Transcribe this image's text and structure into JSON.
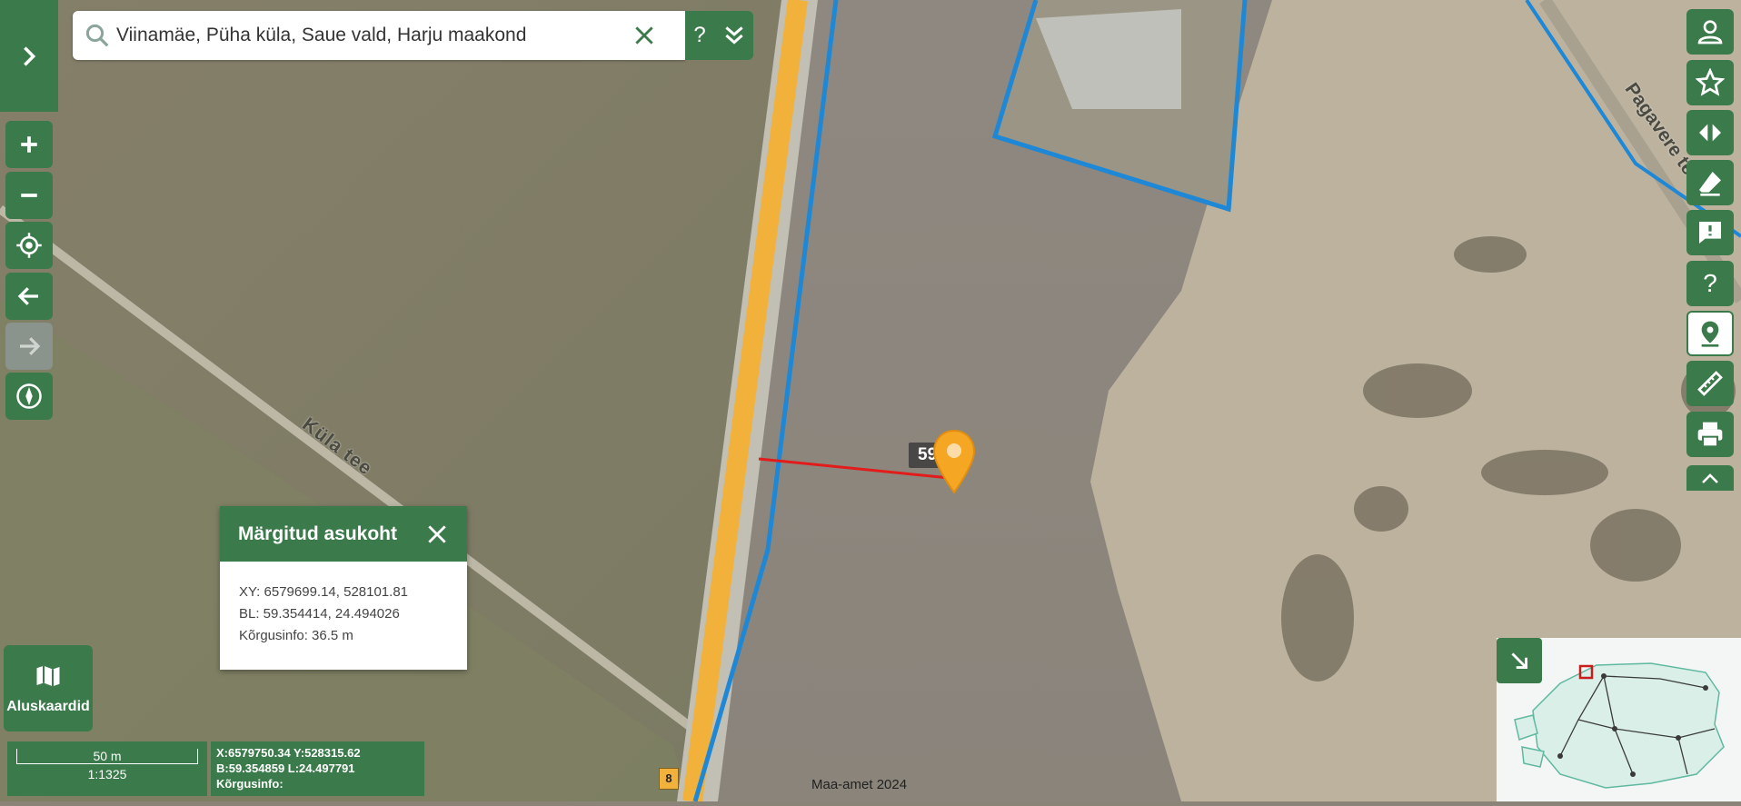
{
  "search": {
    "value": "Viinamäe, Püha küla, Saue vald, Harju maakond",
    "placeholder": ""
  },
  "map": {
    "road_labels": [
      "Küla tee",
      "Pagavere tee"
    ],
    "road_number": "8",
    "measure_label": "59 m",
    "attribution": "Maa-amet 2024"
  },
  "popup": {
    "title": "Märgitud asukoht",
    "xy": "XY: 6579699.14, 528101.81",
    "bl": "BL: 59.354414, 24.494026",
    "height": "Kõrgusinfo: 36.5 m"
  },
  "basemaps": {
    "label": "Aluskaardid"
  },
  "scale": {
    "distance": "50 m",
    "ratio": "1:1325"
  },
  "cursor_coords": {
    "xy": "X:6579750.34 Y:528315.62",
    "bl": "B:59.354859 L:24.497791",
    "height": "Kõrgusinfo:"
  },
  "colors": {
    "accent": "#3b7a4a",
    "marker": "#f5a623",
    "parcel_line": "#1e88d6",
    "measure_line": "#e21b1b",
    "road": "#f2b13a"
  },
  "icons": {
    "left": [
      "chevron-right-icon",
      "zoom-in-icon",
      "zoom-out-icon",
      "locate-icon",
      "back-arrow-icon",
      "forward-arrow-icon",
      "compass-icon"
    ],
    "right": [
      "user-icon",
      "star-icon",
      "compare-icon",
      "eraser-icon",
      "feedback-icon",
      "help-icon",
      "location-pin-icon",
      "ruler-icon",
      "print-icon",
      "chevron-up-icon"
    ]
  }
}
